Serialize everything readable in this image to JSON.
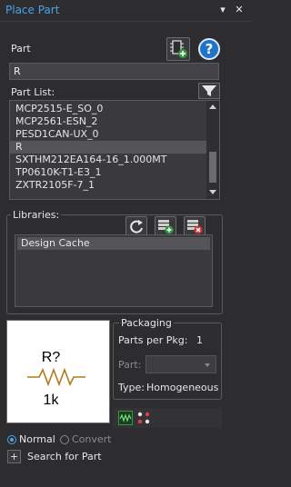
{
  "window": {
    "title": "Place Part",
    "dropdown_glyph": "▾",
    "pin_glyph": "✕"
  },
  "part": {
    "label": "Part",
    "value": "R",
    "help_glyph": "?"
  },
  "part_list": {
    "label": "Part List:",
    "items": [
      "MCP2515-E_SO_0",
      "MCP2561-ESN_2",
      "PESD1CAN-UX_0",
      "R",
      "SXTHM212EA164-16_1.000MT",
      "TP0610K-T1-E3_1",
      "ZXTR2105F-7_1"
    ],
    "selected_index": 3
  },
  "libraries": {
    "label": "Libraries:",
    "items": [
      "Design Cache"
    ]
  },
  "preview": {
    "ref": "R?",
    "value": "1k"
  },
  "packaging": {
    "title": "Packaging",
    "parts_per_pkg_label": "Parts per Pkg:",
    "parts_per_pkg_value": "1",
    "part_label": "Part:",
    "type_label": "Type:",
    "type_value": "Homogeneous"
  },
  "mode": {
    "normal_label": "Normal",
    "convert_label": "Convert",
    "selected": "Normal"
  },
  "search": {
    "plus_glyph": "+",
    "label": "Search for Part"
  },
  "colors": {
    "background": "#2d2d30",
    "accent": "#4aa3e8",
    "help_blue": "#1f73c9",
    "resistor": "#b07a1a"
  }
}
